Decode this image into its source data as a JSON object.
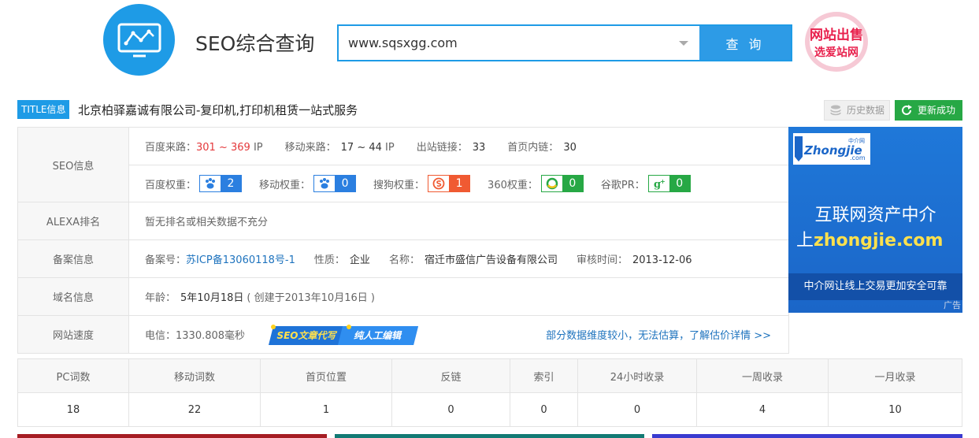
{
  "header": {
    "site_title": "SEO综合查询",
    "search_value": "www.sqsxgg.com",
    "search_button": "查 询",
    "promo_line1": "网站出售",
    "promo_line2": "选爱站网"
  },
  "title_row": {
    "tag": "TITLE信息",
    "text": "北京柏驿嘉诚有限公司-复印机,打印机租赁一站式服务",
    "history_button": "历史数据",
    "refresh_button": "更新成功"
  },
  "seo_info": {
    "label": "SEO信息",
    "baidu_traffic_label": "百度来路：",
    "baidu_traffic_value": "301 ~ 369",
    "baidu_traffic_unit": "IP",
    "mobile_traffic_label": "移动来路：",
    "mobile_traffic_value": "17 ~ 44",
    "mobile_traffic_unit": "IP",
    "outbound_label": "出站链接：",
    "outbound_value": "33",
    "inner_label": "首页内链：",
    "inner_value": "30",
    "weights": [
      {
        "label": "百度权重：",
        "value": "2",
        "icon": "paw-icon"
      },
      {
        "label": "移动权重：",
        "value": "0",
        "icon": "paw-icon"
      },
      {
        "label": "搜狗权重：",
        "value": "1",
        "icon": "sogou-icon"
      },
      {
        "label": "360权重：",
        "value": "0",
        "icon": "360-icon"
      },
      {
        "label": "谷歌PR：",
        "value": "0",
        "icon": "google-plus-icon"
      }
    ]
  },
  "alexa": {
    "label": "ALEXA排名",
    "value": "暂无排名或相关数据不充分"
  },
  "icp": {
    "label": "备案信息",
    "number_label": "备案号：",
    "number_value": "苏ICP备13060118号-1",
    "type_label": "性质：",
    "type_value": "企业",
    "name_label": "名称：",
    "name_value": "宿迁市盛信广告设备有限公司",
    "date_label": "审核时间：",
    "date_value": "2013-12-06"
  },
  "domain": {
    "label": "域名信息",
    "age_label": "年龄：",
    "age_value": "5年10月18日",
    "created": "( 创建于2013年10月16日 )"
  },
  "speed": {
    "label": "网站速度",
    "value": "电信：1330.808毫秒",
    "banner_left": "SEO文章代写",
    "banner_right": "纯人工编辑",
    "notice": "部分数据维度较小，无法估算，了解估价详情 >>"
  },
  "ad": {
    "logo_text": "Zhongjie",
    "logo_sub": ".com",
    "logo_cn": "中介网",
    "line1": "互联网资产中介",
    "line2_prefix": "上",
    "line2_domain": "zhongjie.com",
    "bar": "中介网让线上交易更加安全可靠",
    "tag": "广告"
  },
  "stats": {
    "headers": [
      "PC词数",
      "移动词数",
      "首页位置",
      "反链",
      "索引",
      "24小时收录",
      "一周收录",
      "一月收录"
    ],
    "values": [
      "18",
      "22",
      "1",
      "0",
      "0",
      "0",
      "4",
      "10"
    ]
  },
  "colors": {
    "primary": "#1e9be6",
    "red": "#e4393c",
    "green": "#27a845",
    "link": "#1e73be"
  }
}
